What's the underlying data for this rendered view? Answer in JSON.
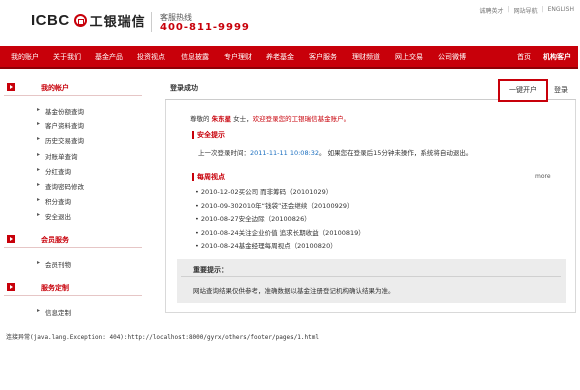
{
  "header": {
    "logo_en": "ICBC",
    "logo_cn": "工银瑞信",
    "hotline_label": "客服热线",
    "hotline_number": "400-811-9999",
    "top_links": [
      "诚聘英才",
      "网站导航",
      "ENGLISH"
    ]
  },
  "nav": {
    "items": [
      "我的账户",
      "关于我们",
      "基金产品",
      "投资视点",
      "信息披露",
      "专户理财",
      "养老基金",
      "客户服务",
      "理财频道",
      "网上交易",
      "公司微博"
    ],
    "right_items": [
      "首页",
      "机构客户"
    ]
  },
  "sidebar": {
    "sections": [
      {
        "title": "我的帐户",
        "links": [
          "基金份额查询",
          "客户资料查询",
          "历史交易查询",
          "对账单查询",
          "分红查询",
          "查询密码修改",
          "积分查询",
          "安全退出"
        ]
      },
      {
        "title": "会员服务",
        "links": [
          "会员刊物"
        ]
      },
      {
        "title": "服务定制",
        "links": [
          "信息定制"
        ]
      }
    ]
  },
  "main": {
    "tab_active": "登录成功",
    "open_account_label": "一键开户",
    "login_label": "登录",
    "welcome_prefix": "尊敬的",
    "welcome_name": "朱东星",
    "welcome_title": "女士，",
    "welcome_msg": "欢迎登录您的工银瑞信基金账户。",
    "security": {
      "title": "安全提示",
      "text_prefix": "上一次登录时间：",
      "time": "2011-11-11 10:08:32",
      "text_suffix": "。 如果您在登录后15分钟未操作，系统将自动退出。"
    },
    "weekly": {
      "title": "每周视点",
      "more": "more",
      "items": [
        "2010-12-02买公司 而非筹码（20101029）",
        "2010-09-302010年“钱袋”还会继续（20100929）",
        "2010-08-27安全边际（20100826）",
        "2010-08-24关注企业价值 追求长期收益（20100819）",
        "2010-08-24基金经理每周视点（20100820）"
      ]
    },
    "notice": {
      "title": "重要提示：",
      "text": "网站查询结果仅供参考，准确数据以基金注册登记机构确认结果为准。"
    }
  },
  "footer": {
    "error": "连接异常(java.lang.Exception: 404):http://localhost:8000/gyrx/others/footer/pages/1.html"
  }
}
